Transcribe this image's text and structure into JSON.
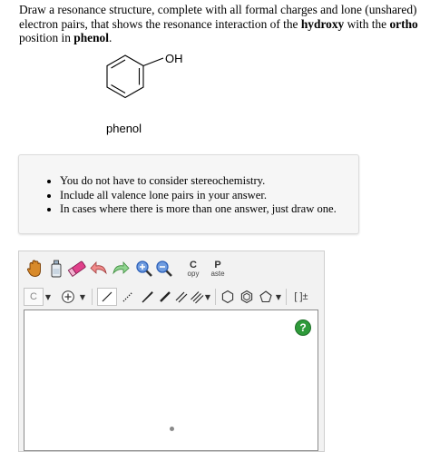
{
  "question": {
    "part1": "Draw a resonance structure, complete with all formal charges and lone (unshared) electron pairs, that shows the resonance interaction of the ",
    "bold1": "hydroxy",
    "part2": " with the ",
    "bold2": "ortho",
    "part3": " position in ",
    "bold3": "phenol",
    "part4": "."
  },
  "molecule": {
    "group_label": "OH",
    "name": "phenol"
  },
  "hints": [
    "You do not have to consider stereochemistry.",
    "Include all valence lone pairs in your answer.",
    "In cases where there is more than one answer, just draw one."
  ],
  "editor": {
    "toolbar_top": {
      "copy_top": "C",
      "copy_bottom": "opy",
      "paste_top": "P",
      "paste_bottom": "aste"
    },
    "toolbar_bottom": {
      "atom_select": "C",
      "bracket_label": "[ ]±"
    },
    "help_label": "?"
  },
  "colors": {
    "help_green": "#2e9a3a",
    "eraser_pink": "#e0408a",
    "zoom_blue": "#2b5fb8",
    "hand_orange": "#c76a10"
  }
}
